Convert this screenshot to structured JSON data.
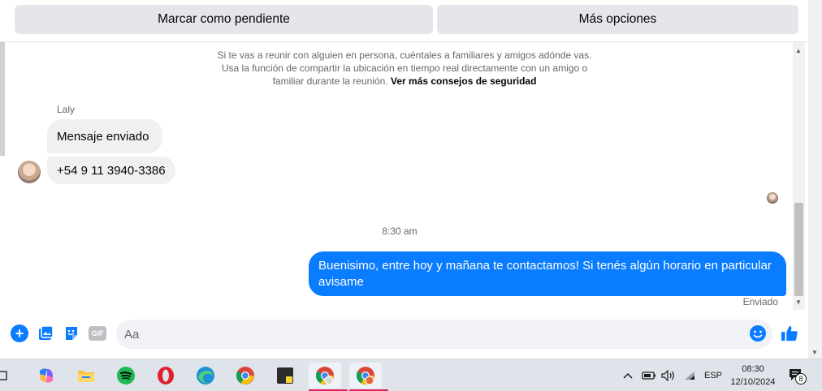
{
  "top_buttons": {
    "mark_pending": "Marcar como pendiente",
    "more_options": "Más opciones"
  },
  "safety_notice": {
    "text": "Si te vas a reunir con alguien en persona, cuéntales a familiares y amigos adónde vas. Usa la función de compartir la ubicación en tiempo real directamente con un amigo o familiar durante la reunión.",
    "link": "Ver más consejos de seguridad"
  },
  "incoming": {
    "sender_name": "Laly",
    "messages": [
      "Mensaje enviado",
      "+54 9 11 3940-3386"
    ]
  },
  "timestamp": "8:30 am",
  "outgoing": {
    "message": "Buenisimo, entre hoy y mañana te contactamos! Si tenés algún horario en particular avisame",
    "status": "Enviado"
  },
  "composer": {
    "placeholder": "Aa",
    "gif_label": "GIF"
  },
  "taskbar": {
    "language": "ESP",
    "time": "08:30",
    "date": "12/10/2024",
    "notification_count": "8",
    "apps": [
      "copilot-icon",
      "file-explorer-icon",
      "spotify-icon",
      "opera-icon",
      "edge-icon",
      "chrome-icon",
      "sticky-notes-icon",
      "chrome-profile-icon",
      "chrome-profile-icon"
    ]
  },
  "colors": {
    "accent": "#0a7cff",
    "incoming_bubble": "#f0f0f0",
    "button_bg": "#e4e6eb"
  }
}
